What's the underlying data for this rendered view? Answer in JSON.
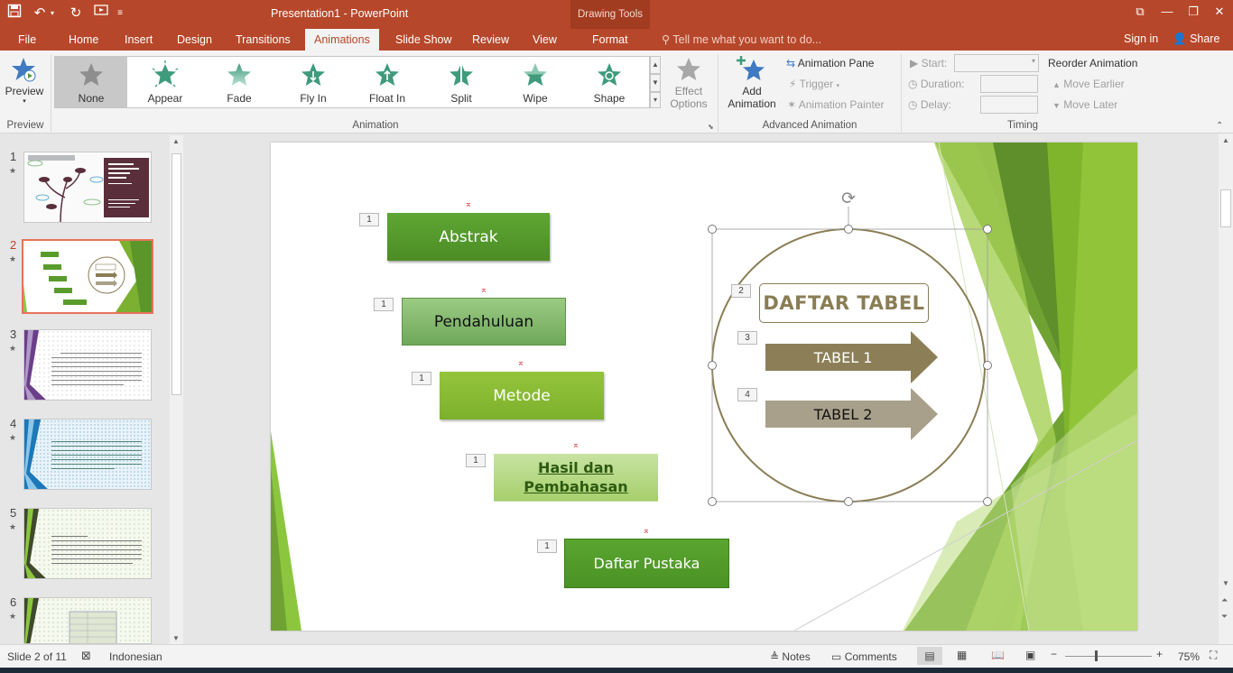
{
  "app": {
    "document_title": "Presentation1 - PowerPoint",
    "contextual_tab_group": "Drawing Tools",
    "accent": "#b7472a"
  },
  "tabs": [
    "File",
    "Home",
    "Insert",
    "Design",
    "Transitions",
    "Animations",
    "Slide Show",
    "Review",
    "View",
    "Format"
  ],
  "active_tab": "Animations",
  "tell_me": "Tell me what you want to do...",
  "account": {
    "sign_in": "Sign in",
    "share": "Share"
  },
  "ribbon": {
    "preview": {
      "label": "Preview",
      "group": "Preview"
    },
    "animation_gallery": {
      "items": [
        "None",
        "Appear",
        "Fade",
        "Fly In",
        "Float In",
        "Split",
        "Wipe",
        "Shape"
      ],
      "selected": "None",
      "group": "Animation"
    },
    "effect_options": {
      "line1": "Effect",
      "line2": "Options"
    },
    "add_animation": {
      "line1": "Add",
      "line2": "Animation"
    },
    "advanced": {
      "animation_pane": "Animation Pane",
      "trigger": "Trigger",
      "animation_painter": "Animation Painter",
      "group": "Advanced Animation"
    },
    "timing": {
      "start_label": "Start:",
      "duration_label": "Duration:",
      "delay_label": "Delay:",
      "reorder": "Reorder Animation",
      "move_earlier": "Move Earlier",
      "move_later": "Move Later",
      "group": "Timing"
    }
  },
  "thumbnails": [
    {
      "num": "1",
      "title": "LAPORAN PRAKTIKUM EKOLOGI DASAR"
    },
    {
      "num": "2",
      "title": "DAFTAR TABEL"
    },
    {
      "num": "3",
      "title": "ABSTRACT"
    },
    {
      "num": "4",
      "title": "PENDAHULUAN"
    },
    {
      "num": "5",
      "title": "METODE"
    },
    {
      "num": "6",
      "title": "HASIL DAN PEMBAHASAN"
    }
  ],
  "active_slide": "2",
  "slide": {
    "boxes": [
      {
        "text": "Abstrak",
        "tag": "1"
      },
      {
        "text": "Pendahuluan",
        "tag": "1"
      },
      {
        "text": "Metode",
        "tag": "1"
      },
      {
        "text": "Hasil dan Pembahasan",
        "tag": "1"
      },
      {
        "text": "Daftar Pustaka",
        "tag": "1"
      }
    ],
    "daftar_tabel": {
      "title": "DAFTAR TABEL",
      "tag": "2"
    },
    "arrows": [
      {
        "text": "TABEL 1",
        "tag": "3"
      },
      {
        "text": "TABEL 2",
        "tag": "4"
      }
    ]
  },
  "status": {
    "slide_info": "Slide 2 of 11",
    "language": "Indonesian",
    "notes": "Notes",
    "comments": "Comments",
    "zoom": "75%"
  }
}
